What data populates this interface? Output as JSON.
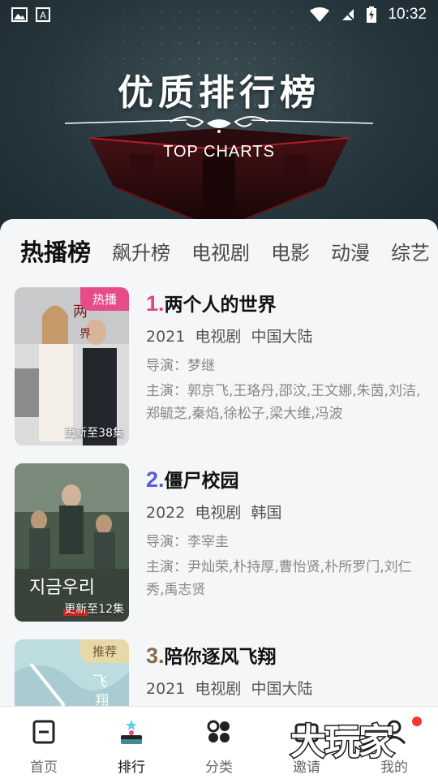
{
  "status_bar": {
    "time": "10:32"
  },
  "banner": {
    "title": "优质排行榜",
    "subtitle": "TOP CHARTS"
  },
  "tabs": [
    {
      "label": "热播榜",
      "active": true
    },
    {
      "label": "飙升榜"
    },
    {
      "label": "电视剧"
    },
    {
      "label": "电影"
    },
    {
      "label": "动漫"
    },
    {
      "label": "综艺"
    }
  ],
  "items": [
    {
      "rank": "1.",
      "rank_color": "#e0457b",
      "title": "两个人的世界",
      "year": "2021",
      "category": "电视剧",
      "region": "中国大陆",
      "director": "导演：梦继",
      "cast": "主演：郭京飞,王珞丹,邵汶,王文娜,朱茵,刘洁,郑毓芝,秦焰,徐松子,梁大维,冯波",
      "badge": "热播",
      "badge_color": "#e54d8a",
      "episodes": "更新至38集"
    },
    {
      "rank": "2.",
      "rank_color": "#5b5be0",
      "title": "僵尸校园",
      "year": "2022",
      "category": "电视剧",
      "region": "韩国",
      "director": "导演：李宰圭",
      "cast": "主演：尹灿荣,朴持厚,曹怡贤,朴所罗门,刘仁秀,禹志贤",
      "badge": "",
      "episodes": "更新至12集"
    },
    {
      "rank": "3.",
      "rank_color": "#8a6a4a",
      "title": "陪你逐风飞翔",
      "year": "2021",
      "category": "电视剧",
      "region": "中国大陆",
      "director": "",
      "cast": "",
      "badge": "推荐",
      "badge_color": "#e8d8a8",
      "episodes": ""
    }
  ],
  "bottom_nav": [
    {
      "label": "首页",
      "icon": "home-icon"
    },
    {
      "label": "排行",
      "icon": "rank-icon",
      "active": true
    },
    {
      "label": "分类",
      "icon": "category-icon"
    },
    {
      "label": "邀请",
      "icon": "invite-icon"
    },
    {
      "label": "我的",
      "icon": "profile-icon"
    }
  ],
  "watermark": "大玩家"
}
